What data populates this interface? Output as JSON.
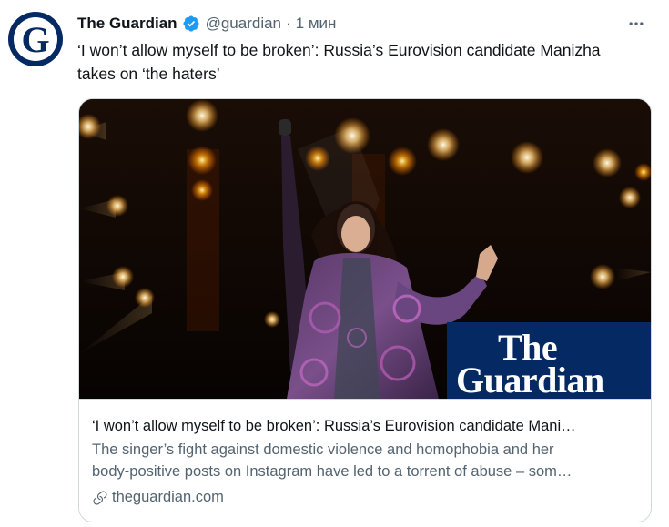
{
  "account": {
    "name": "The Guardian",
    "handle": "@guardian",
    "separator": "·",
    "time": "1 мин",
    "avatar_letter": "G",
    "avatar_color": "#052962"
  },
  "tweet": {
    "text": "‘I won’t allow myself to be broken’: Russia’s Eurovision candidate Manizha takes on ‘the haters’"
  },
  "card": {
    "image_logo": {
      "line1": "The",
      "line2": "Guardian",
      "color": "#052962"
    },
    "title": "‘I won’t allow myself to be broken’: Russia’s Eurovision candidate Mani…",
    "description_line1": "The singer’s fight against domestic violence and homophobia and her",
    "description_line2": "body-positive posts on Instagram have led to a torrent of abuse – som…",
    "domain": "theguardian.com"
  },
  "icons": {
    "verified": "verified-badge-icon",
    "more": "more-horizontal-icon",
    "link": "link-icon"
  },
  "colors": {
    "text_primary": "#0f1419",
    "text_secondary": "#536471",
    "verified_blue": "#1d9bf0",
    "border": "#cfd9de"
  }
}
